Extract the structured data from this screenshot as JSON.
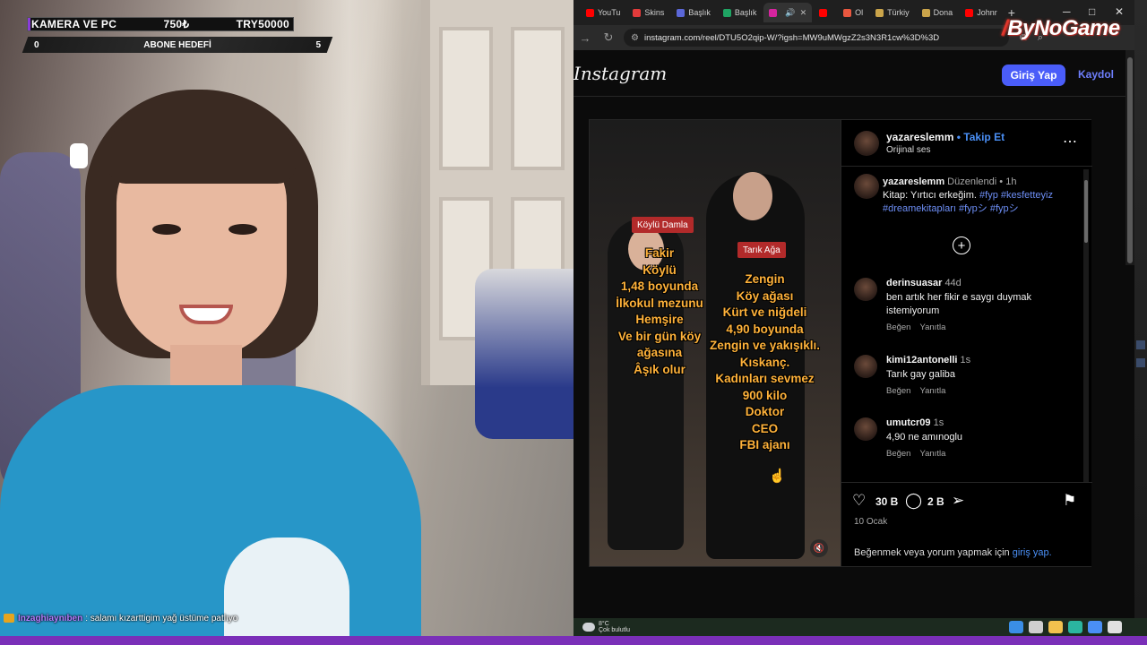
{
  "stream_overlay": {
    "goal_left": "KAMERA VE PC",
    "goal_mid": "750₺",
    "goal_right": "TRY50000",
    "sub_goal_start": "0",
    "sub_goal_label": "ABONE HEDEFİ",
    "sub_goal_end": "5",
    "chat": {
      "user": "Inzaghiaynıben",
      "message": ": salamı kızarttigim yağ üstüme patlıyo"
    }
  },
  "browser": {
    "tabs": [
      {
        "label": "YouTu",
        "color": "#ff0000"
      },
      {
        "label": "Skins",
        "color": "#e23b3b"
      },
      {
        "label": "Başlık",
        "color": "#5b67d8"
      },
      {
        "label": "Başlık",
        "color": "#1fa463"
      },
      {
        "label": "",
        "color": "#d6249f",
        "active": true
      },
      {
        "label": "",
        "color": "#ff0000"
      },
      {
        "label": "Ol",
        "color": "#e9573f"
      },
      {
        "label": "Türkiy",
        "color": "#caa44a"
      },
      {
        "label": "Dona",
        "color": "#caa44a"
      },
      {
        "label": "Johnr",
        "color": "#ff0000"
      }
    ],
    "url": "instagram.com/reel/DTU5O2qip-W/?igsh=MW9uMWgzZ2s3N3R1cw%3D%3D",
    "logo_text": "ByNoGame"
  },
  "instagram": {
    "logo": "Instagram",
    "login_label": "Giriş Yap",
    "signup_label": "Kaydol",
    "reel": {
      "tag_left": "Köylü Damla",
      "tag_right": "Tarık Ağa",
      "text_left": "Fakir\nKöylü\n1,48 boyunda\nİlkokul mezunu\nHemşire\nVe bir gün köy\nağasına\nÂşık olur",
      "text_right": "Zengin\nKöy ağası\nKürt ve niğdeli\n4,90 boyunda\nZengin ve yakışıklı.\nKıskanç.\nKadınları sevmez\n900 kilo\nDoktor\nCEO\nFBI ajanı"
    },
    "author": "yazareslemm",
    "follow_label": "Takip Et",
    "audio": "Orijinal ses",
    "caption": {
      "user": "yazareslemm",
      "edited": "Düzenlendi",
      "time": "1h",
      "text": "Kitap: Yırtıcı erkeğim.",
      "tags": "#fyp #kesfetteyiz #dreamekitapları #fypシ #fypシ"
    },
    "comments": [
      {
        "user": "derinsuasar",
        "time": "44d",
        "text": "ben artık her fikir e saygı duymak istemiyorum"
      },
      {
        "user": "kimi12antonelli",
        "time": "1s",
        "text": "Tarık gay galiba"
      },
      {
        "user": "umutcr09",
        "time": "1s",
        "text": "4,90 ne amınoglu"
      }
    ],
    "like_label": "Beğen",
    "reply_label": "Yanıtla",
    "likes": "30 B",
    "comment_count": "2 B",
    "date": "10 Ocak",
    "login_hint_pre": "Beğenmek veya yorum yapmak için",
    "login_hint_link": "giriş yap."
  },
  "taskbar": {
    "temp": "8°C",
    "weather": "Çok bulutlu"
  }
}
